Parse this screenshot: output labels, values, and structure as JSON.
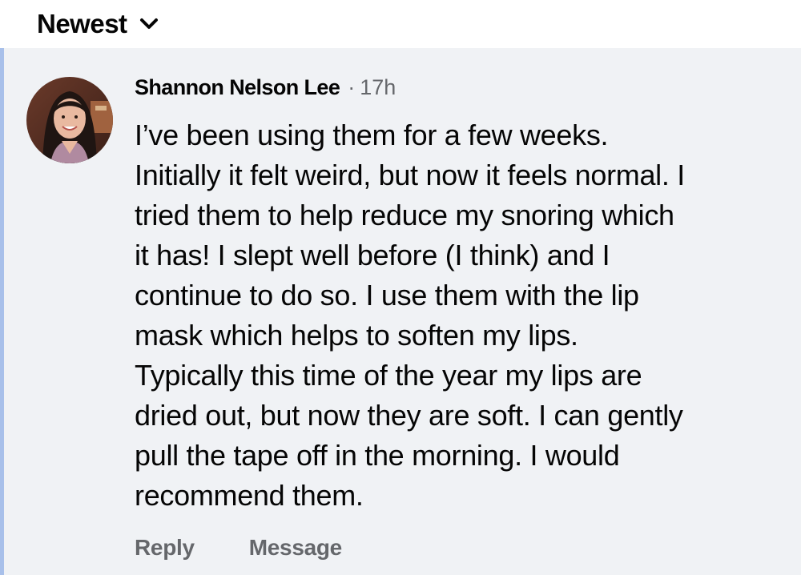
{
  "sort": {
    "label": "Newest",
    "icon": "chevron-down-icon"
  },
  "comment": {
    "author": "Shannon Nelson Lee",
    "separator": "·",
    "timestamp": "17h",
    "text": "I’ve been using them for a few weeks.\nInitially it felt weird, but now it feels normal. I\ntried them to help reduce my snoring which\nit has! I slept well before (I think) and I\ncontinue to do so. I use them with the lip\nmask which helps to soften my lips.\nTypically this time of the year my lips are\ndried out, but now they are soft. I can gently\npull the tape off in the morning. I would\nrecommend them.",
    "avatar": "profile-photo"
  },
  "actions": {
    "reply": "Reply",
    "message": "Message"
  },
  "colors": {
    "comment_background": "#f0f2f5",
    "accent_bar": "#a8c0ea",
    "primary_text": "#050505",
    "secondary_text": "#65676b"
  }
}
